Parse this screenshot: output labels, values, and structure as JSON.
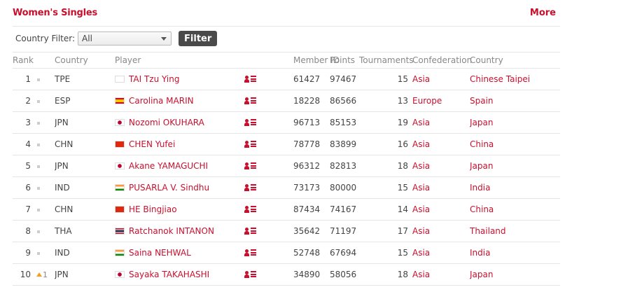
{
  "header": {
    "title": "Women's Singles",
    "more_label": "More"
  },
  "filter": {
    "label": "Country Filter:",
    "selected": "All",
    "button_label": "Filter"
  },
  "columns": {
    "rank": "Rank",
    "country": "Country",
    "player": "Player",
    "member_id": "Member ID",
    "points": "Points",
    "tournaments": "Tournaments",
    "confederation": "Confederation",
    "country_name": "Country"
  },
  "rows": [
    {
      "rank": "1",
      "change": "",
      "code": "TPE",
      "flag": "tpe",
      "player": "TAI Tzu Ying",
      "member_id": "61427",
      "points": "97467",
      "tournaments": "15",
      "confederation": "Asia",
      "country_name": "Chinese Taipei"
    },
    {
      "rank": "2",
      "change": "",
      "code": "ESP",
      "flag": "esp",
      "player": "Carolina MARIN",
      "member_id": "18228",
      "points": "86566",
      "tournaments": "13",
      "confederation": "Europe",
      "country_name": "Spain"
    },
    {
      "rank": "3",
      "change": "",
      "code": "JPN",
      "flag": "jpn",
      "player": "Nozomi OKUHARA",
      "member_id": "96713",
      "points": "85153",
      "tournaments": "19",
      "confederation": "Asia",
      "country_name": "Japan"
    },
    {
      "rank": "4",
      "change": "",
      "code": "CHN",
      "flag": "chn",
      "player": "CHEN Yufei",
      "member_id": "78778",
      "points": "83899",
      "tournaments": "16",
      "confederation": "Asia",
      "country_name": "China"
    },
    {
      "rank": "5",
      "change": "",
      "code": "JPN",
      "flag": "jpn",
      "player": "Akane YAMAGUCHI",
      "member_id": "96312",
      "points": "82813",
      "tournaments": "18",
      "confederation": "Asia",
      "country_name": "Japan"
    },
    {
      "rank": "6",
      "change": "",
      "code": "IND",
      "flag": "ind",
      "player": "PUSARLA V. Sindhu",
      "member_id": "73173",
      "points": "80000",
      "tournaments": "15",
      "confederation": "Asia",
      "country_name": "India"
    },
    {
      "rank": "7",
      "change": "",
      "code": "CHN",
      "flag": "chn",
      "player": "HE Bingjiao",
      "member_id": "87434",
      "points": "74167",
      "tournaments": "14",
      "confederation": "Asia",
      "country_name": "China"
    },
    {
      "rank": "8",
      "change": "",
      "code": "THA",
      "flag": "tha",
      "player": "Ratchanok INTANON",
      "member_id": "35642",
      "points": "71197",
      "tournaments": "17",
      "confederation": "Asia",
      "country_name": "Thailand"
    },
    {
      "rank": "9",
      "change": "",
      "code": "IND",
      "flag": "ind",
      "player": "Saina NEHWAL",
      "member_id": "52748",
      "points": "67694",
      "tournaments": "15",
      "confederation": "Asia",
      "country_name": "India"
    },
    {
      "rank": "10",
      "change": "1",
      "code": "JPN",
      "flag": "jpn",
      "player": "Sayaka TAKAHASHI",
      "member_id": "34890",
      "points": "58056",
      "tournaments": "18",
      "confederation": "Asia",
      "country_name": "Japan"
    }
  ],
  "colors": {
    "accent": "#c8102e",
    "button_bg": "#4a4a4a",
    "rank_up": "#f0a020"
  },
  "icons": {
    "profile": "player-profile-icon",
    "select_caret": "chevron-down-icon",
    "rank_change": "arrow-up-icon"
  }
}
